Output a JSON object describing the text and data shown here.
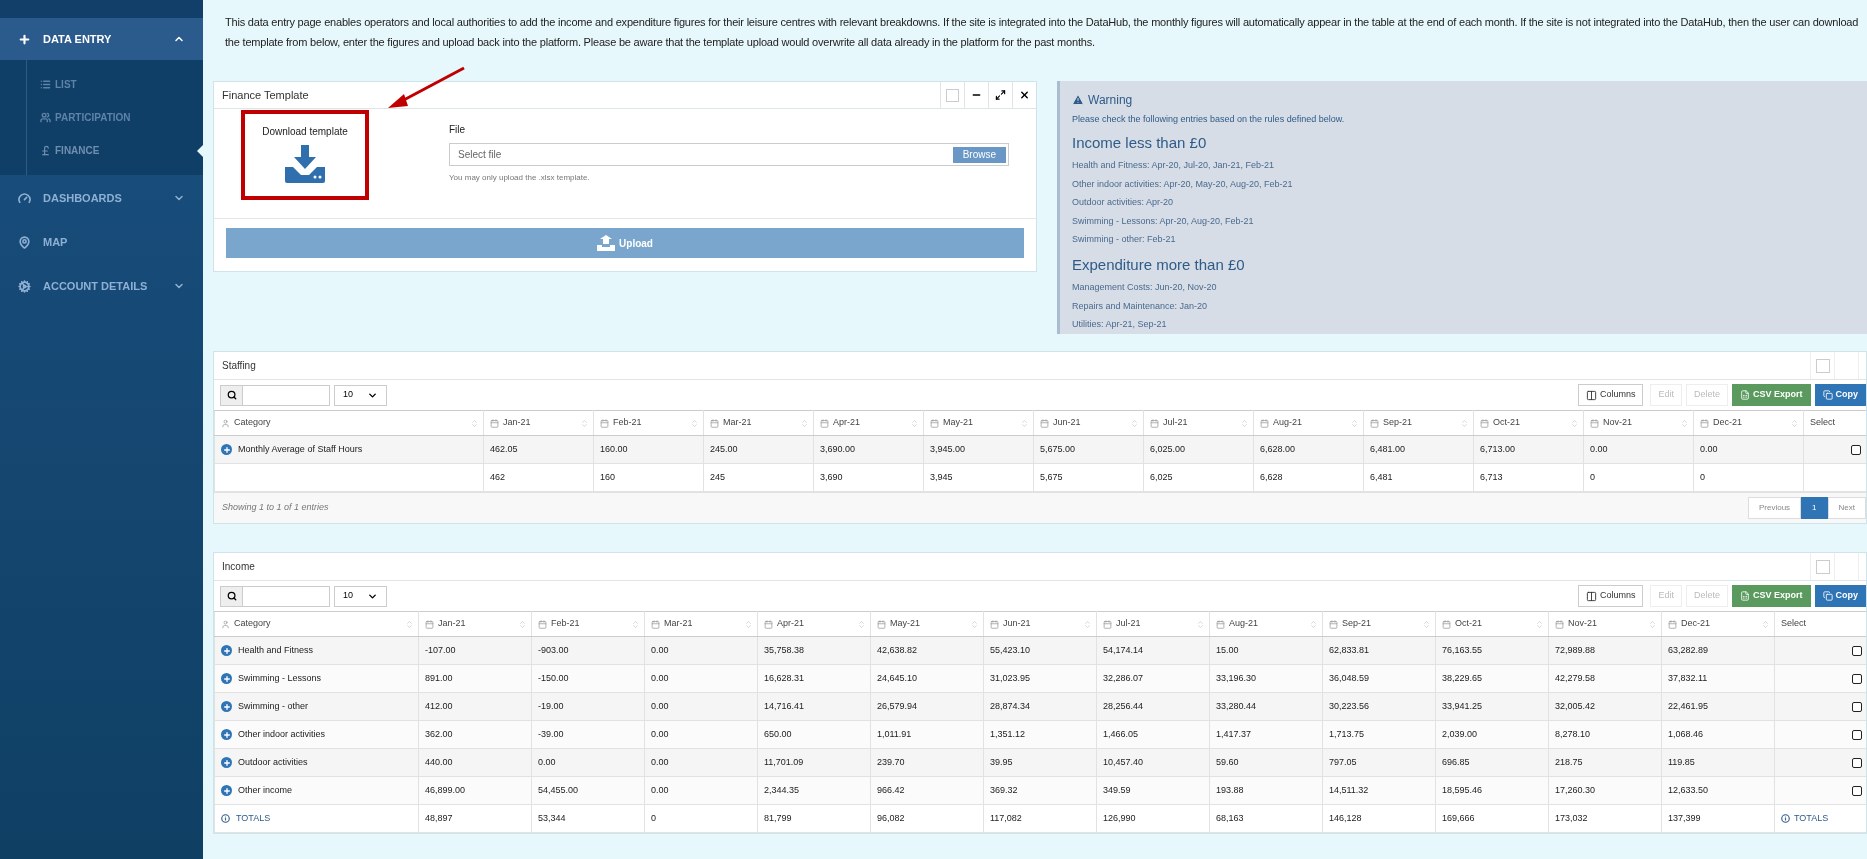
{
  "sidebar": {
    "items": [
      {
        "label": "DATA ENTRY",
        "kind": "group",
        "expanded": true,
        "children": [
          {
            "label": "LIST",
            "selected": false
          },
          {
            "label": "PARTICIPATION",
            "selected": false
          },
          {
            "label": "FINANCE",
            "selected": true
          }
        ]
      },
      {
        "label": "DASHBOARDS",
        "kind": "group",
        "expanded": false
      },
      {
        "label": "MAP",
        "kind": "link"
      },
      {
        "label": "ACCOUNT DETAILS",
        "kind": "group",
        "expanded": false
      }
    ]
  },
  "intro": "This data entry page enables operators and local authorities to add the income and expenditure figures for their leisure centres with relevant breakdowns. If the site is integrated into the DataHub, the monthly figures will automatically appear in the table at the end of each month. If the site is not integrated into the DataHub, then the user can download the template from below, enter the figures and upload back into the platform. Please be aware that the template upload would overwrite all data already in the platform for the past months.",
  "finance_template": {
    "title": "Finance Template",
    "download": {
      "label": "Download template",
      "highlighted": true
    },
    "file_label": "File",
    "placeholder": "Select file",
    "browse": "Browse",
    "hint": "You may only upload the .xlsx template.",
    "upload": "Upload"
  },
  "warning": {
    "title": "Warning",
    "subtitle": "Please check the following entries based on the rules defined below.",
    "sections": [
      {
        "heading": "Income less than £0",
        "lines": [
          "Health and Fitness: Apr-20, Jul-20, Jan-21, Feb-21",
          "Other indoor activities: Apr-20, May-20, Aug-20, Feb-21",
          "Outdoor activities: Apr-20",
          "Swimming - Lessons: Apr-20, Aug-20, Feb-21",
          "Swimming - other: Feb-21"
        ]
      },
      {
        "heading": "Expenditure more than £0",
        "lines": [
          "Management Costs: Jun-20, Nov-20",
          "Repairs and Maintenance: Jan-20",
          "Utilities: Apr-21, Sep-21"
        ]
      }
    ]
  },
  "tables": [
    {
      "title": "Staffing",
      "page_size": "10",
      "buttons": [
        {
          "label": "Columns",
          "kind": "plain",
          "disabled": false
        },
        {
          "label": "Edit",
          "kind": "plain",
          "disabled": true
        },
        {
          "label": "Delete",
          "kind": "plain",
          "disabled": true
        },
        {
          "label": "CSV Export",
          "kind": "success",
          "disabled": false
        },
        {
          "label": "Copy",
          "kind": "primary",
          "disabled": false
        }
      ],
      "columns": [
        {
          "label": "Category",
          "kind": "category"
        },
        {
          "label": "Jan-21",
          "kind": "month"
        },
        {
          "label": "Feb-21",
          "kind": "month"
        },
        {
          "label": "Mar-21",
          "kind": "month"
        },
        {
          "label": "Apr-21",
          "kind": "month"
        },
        {
          "label": "May-21",
          "kind": "month"
        },
        {
          "label": "Jun-21",
          "kind": "month"
        },
        {
          "label": "Jul-21",
          "kind": "month"
        },
        {
          "label": "Aug-21",
          "kind": "month"
        },
        {
          "label": "Sep-21",
          "kind": "month"
        },
        {
          "label": "Oct-21",
          "kind": "month"
        },
        {
          "label": "Nov-21",
          "kind": "month"
        },
        {
          "label": "Dec-21",
          "kind": "month"
        },
        {
          "label": "Select",
          "kind": "select"
        }
      ],
      "rows": [
        {
          "kind": "data",
          "checked": false,
          "cells": [
            "Monthly Average of Staff Hours",
            "462.05",
            "160.00",
            "245.00",
            "3,690.00",
            "3,945.00",
            "5,675.00",
            "6,025.00",
            "6,628.00",
            "6,481.00",
            "6,713.00",
            "0.00",
            "0.00"
          ]
        },
        {
          "kind": "summary",
          "cells": [
            "",
            "462",
            "160",
            "245",
            "3,690",
            "3,945",
            "5,675",
            "6,025",
            "6,628",
            "6,481",
            "6,713",
            "0",
            "0"
          ]
        }
      ],
      "footer": {
        "info": "Showing 1 to 1 of 1 entries",
        "pages": [
          {
            "label": "Previous",
            "selected": false
          },
          {
            "label": "1",
            "selected": true
          },
          {
            "label": "Next",
            "selected": false
          }
        ]
      }
    },
    {
      "title": "Income",
      "page_size": "10",
      "buttons": [
        {
          "label": "Columns",
          "kind": "plain",
          "disabled": false
        },
        {
          "label": "Edit",
          "kind": "plain",
          "disabled": true
        },
        {
          "label": "Delete",
          "kind": "plain",
          "disabled": true
        },
        {
          "label": "CSV Export",
          "kind": "success",
          "disabled": false
        },
        {
          "label": "Copy",
          "kind": "primary",
          "disabled": false
        }
      ],
      "columns": [
        {
          "label": "Category",
          "kind": "category"
        },
        {
          "label": "Jan-21",
          "kind": "month"
        },
        {
          "label": "Feb-21",
          "kind": "month"
        },
        {
          "label": "Mar-21",
          "kind": "month"
        },
        {
          "label": "Apr-21",
          "kind": "month"
        },
        {
          "label": "May-21",
          "kind": "month"
        },
        {
          "label": "Jun-21",
          "kind": "month"
        },
        {
          "label": "Jul-21",
          "kind": "month"
        },
        {
          "label": "Aug-21",
          "kind": "month"
        },
        {
          "label": "Sep-21",
          "kind": "month"
        },
        {
          "label": "Oct-21",
          "kind": "month"
        },
        {
          "label": "Nov-21",
          "kind": "month"
        },
        {
          "label": "Dec-21",
          "kind": "month"
        },
        {
          "label": "Select",
          "kind": "select"
        }
      ],
      "rows": [
        {
          "kind": "data",
          "checked": false,
          "cells": [
            "Health and Fitness",
            "-107.00",
            "-903.00",
            "0.00",
            "35,758.38",
            "42,638.82",
            "55,423.10",
            "54,174.14",
            "15.00",
            "62,833.81",
            "76,163.55",
            "72,989.88",
            "63,282.89"
          ]
        },
        {
          "kind": "data",
          "checked": false,
          "cells": [
            "Swimming - Lessons",
            "891.00",
            "-150.00",
            "0.00",
            "16,628.31",
            "24,645.10",
            "31,023.95",
            "32,286.07",
            "33,196.30",
            "36,048.59",
            "38,229.65",
            "42,279.58",
            "37,832.11"
          ]
        },
        {
          "kind": "data",
          "checked": false,
          "cells": [
            "Swimming - other",
            "412.00",
            "-19.00",
            "0.00",
            "14,716.41",
            "26,579.94",
            "28,874.34",
            "28,256.44",
            "33,280.44",
            "30,223.56",
            "33,941.25",
            "32,005.42",
            "22,461.95"
          ]
        },
        {
          "kind": "data",
          "checked": false,
          "cells": [
            "Other indoor activities",
            "362.00",
            "-39.00",
            "0.00",
            "650.00",
            "1,011.91",
            "1,351.12",
            "1,466.05",
            "1,417.37",
            "1,713.75",
            "2,039.00",
            "8,278.10",
            "1,068.46"
          ]
        },
        {
          "kind": "data",
          "checked": false,
          "cells": [
            "Outdoor activities",
            "440.00",
            "0.00",
            "0.00",
            "11,701.09",
            "239.70",
            "39.95",
            "10,457.40",
            "59.60",
            "797.05",
            "696.85",
            "218.75",
            "119.85"
          ]
        },
        {
          "kind": "data",
          "checked": false,
          "cells": [
            "Other income",
            "46,899.00",
            "54,455.00",
            "0.00",
            "2,344.35",
            "966.42",
            "369.32",
            "349.59",
            "193.88",
            "14,511.32",
            "18,595.46",
            "17,260.30",
            "12,633.50"
          ]
        },
        {
          "kind": "totals",
          "cells": [
            "TOTALS",
            "48,897",
            "53,344",
            "0",
            "81,799",
            "96,082",
            "117,082",
            "126,990",
            "68,163",
            "146,128",
            "169,666",
            "173,032",
            "137,399"
          ],
          "select_label": "TOTALS"
        }
      ]
    }
  ]
}
